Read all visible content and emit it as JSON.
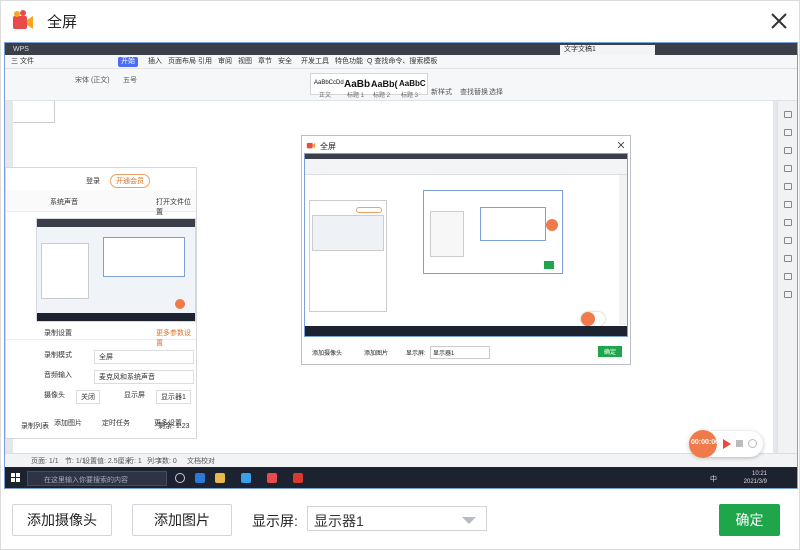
{
  "window": {
    "title": "全屏",
    "logo_icon": "video-camera-logo",
    "close_icon": "close-icon"
  },
  "preview": {
    "wps_tabs": [
      "WPS",
      "文字文稿1"
    ],
    "menu": [
      "三 文件",
      "开始",
      "插入",
      "页面布局",
      "引用",
      "审阅",
      "视图",
      "章节",
      "安全",
      "开发工具",
      "特色功能",
      "Q 查找命令、搜索模板"
    ],
    "menu_active": "开始",
    "ribbon_font": "宋体 (正文)",
    "ribbon_size": "五号",
    "styles": [
      {
        "sample": "AaBbCcDd",
        "caption": "正文"
      },
      {
        "sample": "AaBb",
        "caption": "标题 1"
      },
      {
        "sample": "AaBb(",
        "caption": "标题 2"
      },
      {
        "sample": "AaBbC",
        "caption": "标题 3"
      }
    ],
    "ribbon_extra": [
      "新样式",
      "查找替换",
      "选择"
    ],
    "status": [
      "页面: 1/1",
      "节: 1/1",
      "设置值: 2.5厘米",
      "行: 1",
      "列: 1",
      "字数: 0",
      "文档校对"
    ],
    "taskbar_search": "在这里输入你要搜索的内容",
    "taskbar_time": "10:21",
    "taskbar_date": "2021/3/9",
    "taskbar_ime": "中",
    "recording_time": "00:00:00"
  },
  "inner_dialog": {
    "title": "全屏",
    "left_panel": {
      "login": "登录",
      "vip": "开通会员",
      "system_sound": "系统声音",
      "open_folder": "打开文件位置",
      "record_settings": "录制设置",
      "more_settings": "更多参数设置",
      "record_mode_label": "录制模式",
      "record_mode": "全屏",
      "audio_label": "音频输入",
      "audio_value": "麦克风和系统声音",
      "camera_label": "摄像头",
      "camera_value": "关闭",
      "display_label": "显示屏",
      "display_value": "显示器1",
      "add_image": "添加图片",
      "schedule": "定时任务",
      "more": "更多设置",
      "record_list": "录制列表",
      "remaining": "剩余: 1:23"
    },
    "add_camera": "添加摄像头",
    "add_image": "添加图片",
    "display_label": "显示屏:",
    "display_value": "显示器1",
    "ok": "确定"
  },
  "controls": {
    "add_camera": "添加摄像头",
    "add_image": "添加图片",
    "display_label": "显示屏:",
    "display_value": "显示器1",
    "ok": "确定"
  },
  "colors": {
    "ok_green": "#1fa64a",
    "record_orange": "#f07a4a",
    "taskbar": "#1c2230"
  }
}
